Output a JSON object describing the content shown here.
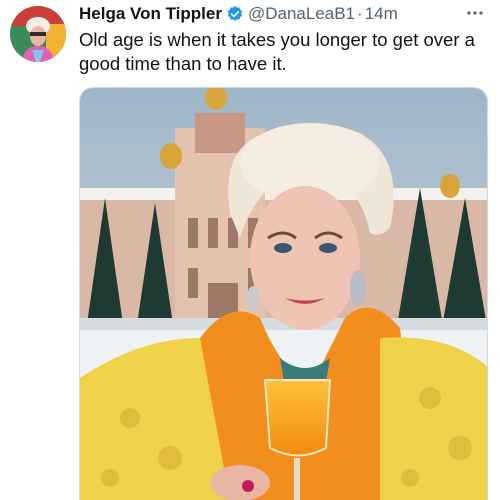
{
  "tweet": {
    "author_name": "Helga Von Tippler",
    "handle": "@DanaLeaB1",
    "separator": "·",
    "time": "14m",
    "text": "Old age is when it takes you longer to get over a good time than to have it.",
    "verified": true
  },
  "icons": {
    "verified": "verified-badge-icon",
    "more": "more-options-icon"
  },
  "colors": {
    "verified_blue": "#1d9bf0",
    "secondary_text": "#536471",
    "primary_text": "#0f1419"
  }
}
